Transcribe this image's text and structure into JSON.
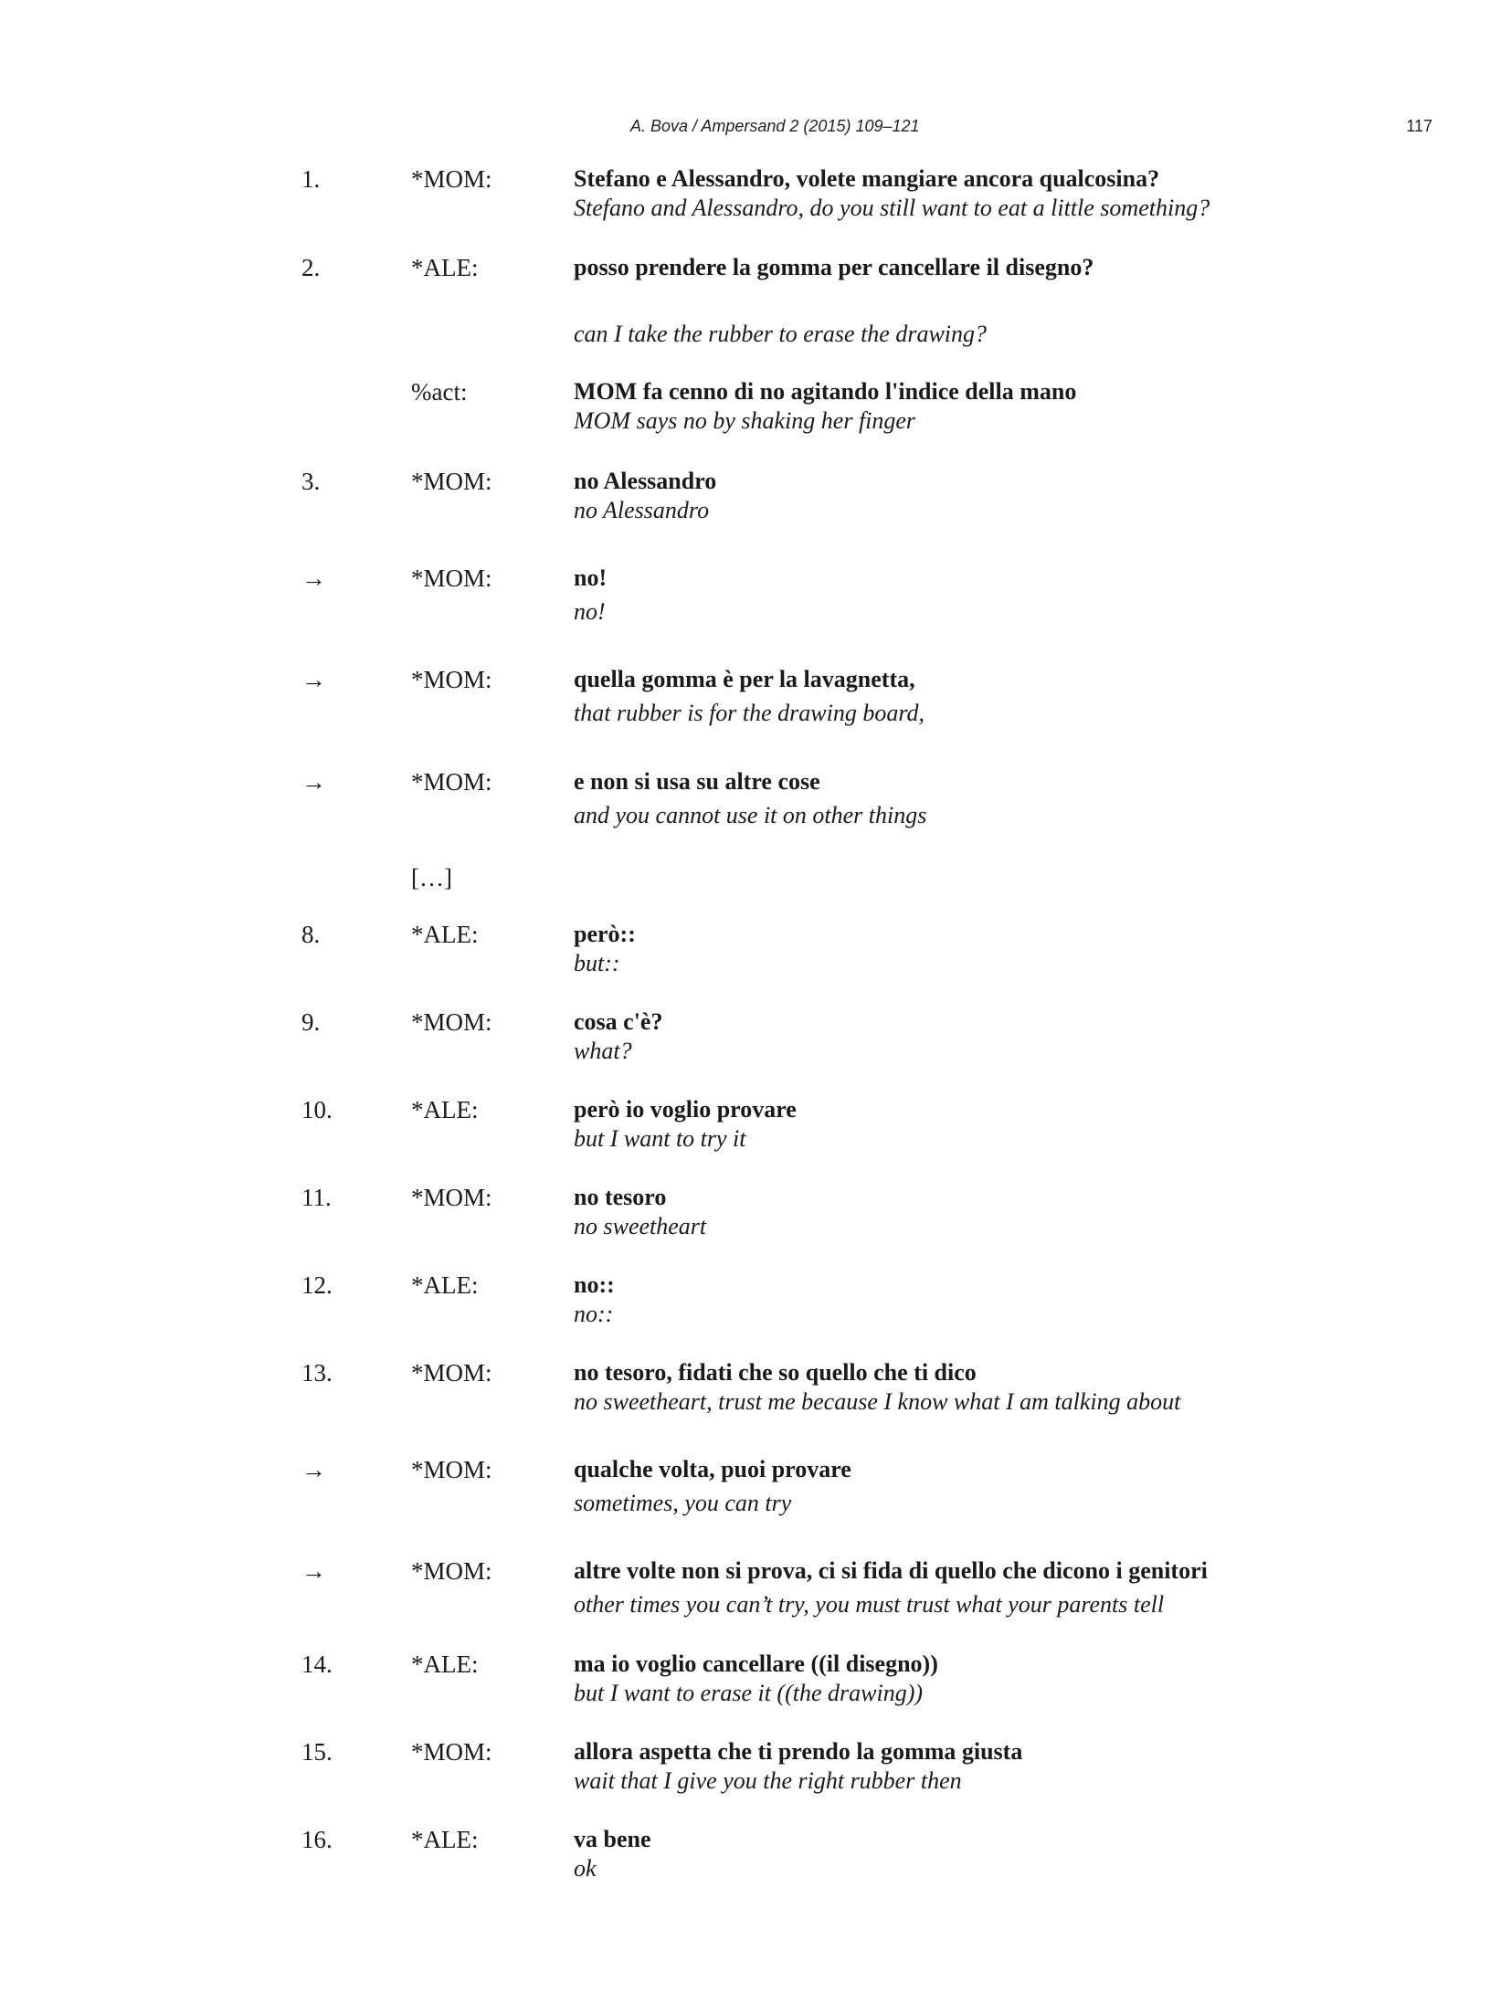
{
  "header": {
    "citation": "A. Bova / Ampersand 2 (2015) 109–121",
    "page_number": "117"
  },
  "turns": [
    {
      "num": "1.",
      "speaker": "*MOM:",
      "original": "Stefano e Alessandro, volete mangiare ancora qualcosina?",
      "translation": "Stefano and Alessandro, do you still want to eat a little something?"
    },
    {
      "num": "2.",
      "speaker": "*ALE:",
      "original": "posso prendere la gomma per cancellare il disegno?",
      "translation": "can I take the rubber to erase the drawing?"
    },
    {
      "num": "",
      "speaker": "%act:",
      "original": "MOM fa cenno di no agitando l'indice della mano",
      "translation": "MOM says no by shaking her finger"
    },
    {
      "num": "3.",
      "speaker": "*MOM:",
      "original": "no Alessandro",
      "translation": "no Alessandro"
    },
    {
      "num": "→",
      "speaker": "*MOM:",
      "original": "no!",
      "translation": "no!"
    },
    {
      "num": "→",
      "speaker": "*MOM:",
      "original": "quella gomma è per la lavagnetta,",
      "translation": "that rubber is for the drawing board,"
    },
    {
      "num": "→",
      "speaker": "*MOM:",
      "original": "e non si usa su altre cose",
      "translation": "and you cannot use it on other things"
    },
    {
      "num": "",
      "speaker": "[…]",
      "original": "",
      "translation": ""
    },
    {
      "num": "8.",
      "speaker": "*ALE:",
      "original": "però::",
      "translation": "but::"
    },
    {
      "num": "9.",
      "speaker": "*MOM:",
      "original": "cosa c'è?",
      "translation": "what?"
    },
    {
      "num": "10.",
      "speaker": "*ALE:",
      "original": "però io voglio provare",
      "translation": "but I want to try it"
    },
    {
      "num": "11.",
      "speaker": "*MOM:",
      "original": "no tesoro",
      "translation": "no sweetheart"
    },
    {
      "num": "12.",
      "speaker": "*ALE:",
      "original": "no::",
      "translation": "no::"
    },
    {
      "num": "13.",
      "speaker": "*MOM:",
      "original": "no tesoro, fidati che so quello che ti dico",
      "translation": "no sweetheart, trust me because I know what I am talking about"
    },
    {
      "num": "→",
      "speaker": "*MOM:",
      "original": "qualche volta, puoi provare",
      "translation": "sometimes, you can try"
    },
    {
      "num": "→",
      "speaker": "*MOM:",
      "original": "altre volte non si prova, ci si fida di quello che dicono i genitori",
      "translation": "other times you can’t try, you must trust what your parents tell"
    },
    {
      "num": "14.",
      "speaker": "*ALE:",
      "original": "ma io voglio cancellare ((il disegno))",
      "translation": "but I want to erase it ((the drawing))"
    },
    {
      "num": "15.",
      "speaker": "*MOM:",
      "original": "allora aspetta che ti prendo la gomma giusta",
      "translation": "wait that I give you the right rubber then"
    },
    {
      "num": "16.",
      "speaker": "*ALE:",
      "original": "va bene",
      "translation": "ok"
    }
  ]
}
